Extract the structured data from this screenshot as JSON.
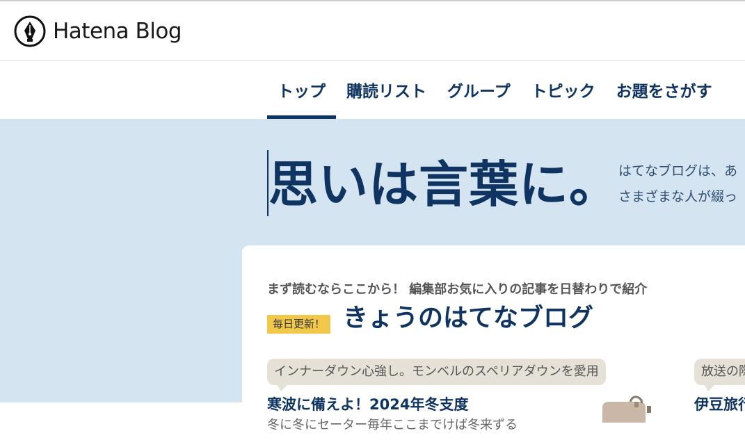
{
  "header": {
    "logo_text": "Hatena Blog",
    "logo_icon": "fountain-pen-nib-icon"
  },
  "nav": {
    "items": [
      {
        "label": "トップ",
        "active": true
      },
      {
        "label": "購読リスト",
        "active": false
      },
      {
        "label": "グループ",
        "active": false
      },
      {
        "label": "トピック",
        "active": false
      },
      {
        "label": "お題をさがす",
        "active": false
      }
    ]
  },
  "hero": {
    "title": "思いは言葉に。",
    "desc_line1": "はてなブログは、あ",
    "desc_line2": "さまざまな人が綴っ"
  },
  "featured": {
    "subtitle": "まず読むならここから！ 編集部お気に入りの記事を日替わりで紹介",
    "badge": "毎日更新！",
    "title": "きょうのはてなブログ",
    "entries": [
      {
        "bubble": "インナーダウン心強し。モンベルのスペリアダウンを愛用",
        "title": "寒波に備えよ！2024年冬支度",
        "excerpt": "冬に冬にセーター毎年ここまでけば冬来ずる"
      },
      {
        "bubble": "放送の際",
        "title": "伊豆旅行"
      }
    ]
  },
  "colors": {
    "brand_navy": "#0f3462",
    "hero_bg": "#d4e4f1",
    "badge_yellow": "#f2c84b",
    "bubble_bg": "#e5e1d6"
  }
}
